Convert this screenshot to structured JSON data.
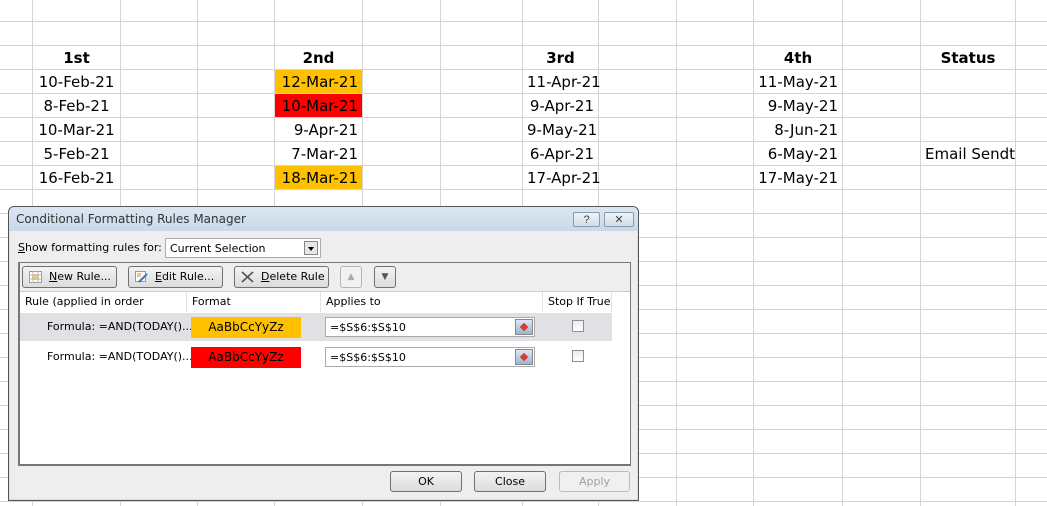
{
  "sheet": {
    "headers": [
      "1st",
      "2nd",
      "3rd",
      "4th",
      "Status"
    ],
    "rows": [
      {
        "c1": "10-Feb-21",
        "c2": "12-Mar-21",
        "c2_fill": "#ffc000",
        "c3": "11-Apr-21",
        "c4": "11-May-21",
        "status": ""
      },
      {
        "c1": "8-Feb-21",
        "c2": "10-Mar-21",
        "c2_fill": "#ff0000",
        "c3": "9-Apr-21",
        "c4": "9-May-21",
        "status": ""
      },
      {
        "c1": "10-Mar-21",
        "c2": "9-Apr-21",
        "c2_fill": "",
        "c3": "9-May-21",
        "c4": "8-Jun-21",
        "status": ""
      },
      {
        "c1": "5-Feb-21",
        "c2": "7-Mar-21",
        "c2_fill": "",
        "c3": "6-Apr-21",
        "c4": "6-May-21",
        "status": "Email Sendt"
      },
      {
        "c1": "16-Feb-21",
        "c2": "18-Mar-21",
        "c2_fill": "#ffc000",
        "c3": "17-Apr-21",
        "c4": "17-May-21",
        "status": ""
      }
    ]
  },
  "dialog": {
    "title": "Conditional Formatting Rules Manager",
    "help_label": "?",
    "close_label": "✕",
    "show_rules_label": "Show formatting rules for:",
    "show_rules_value": "Current Selection",
    "toolbar": {
      "new_rule": "New Rule...",
      "edit_rule": "Edit Rule...",
      "delete_rule": "Delete Rule",
      "move_up_icon": "▲",
      "move_down_icon": "▼"
    },
    "columns": {
      "rule": "Rule (applied in order shown)",
      "format": "Format",
      "applies_to": "Applies to",
      "stop_if_true": "Stop If True"
    },
    "rules": [
      {
        "rule": "Formula: =AND(TODAY()...",
        "preview": "AaBbCcYyZz",
        "fill": "#ffc000",
        "applies_to": "=$S$6:$S$10",
        "stop_if_true": false,
        "selected": true
      },
      {
        "rule": "Formula: =AND(TODAY()...",
        "preview": "AaBbCcYyZz",
        "fill": "#ff0000",
        "applies_to": "=$S$6:$S$10",
        "stop_if_true": false,
        "selected": false
      }
    ],
    "buttons": {
      "ok": "OK",
      "close": "Close",
      "apply": "Apply"
    }
  }
}
